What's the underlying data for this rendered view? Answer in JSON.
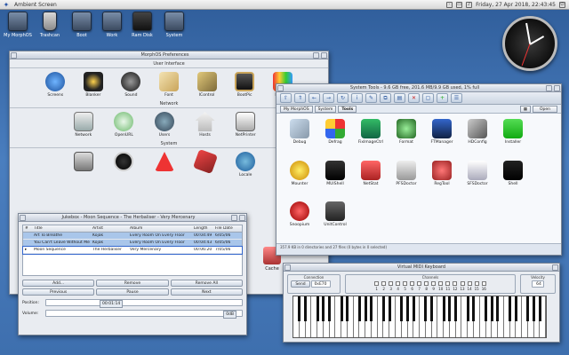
{
  "menubar": {
    "title": "Ambient Screen",
    "datetime": "Friday, 27 Apr 2018, 22:43:45",
    "tray_icons": [
      "chat-icon",
      "screen-icon",
      "volume-icon",
      "power-icon"
    ]
  },
  "desktop_icons": [
    {
      "label": "My MorphOS",
      "icon": "computer-icon"
    },
    {
      "label": "Trashcan",
      "icon": "trash-icon"
    },
    {
      "label": "Boot",
      "icon": "drive-icon"
    },
    {
      "label": "Work",
      "icon": "drive-icon"
    },
    {
      "label": "Ram Disk",
      "icon": "ram-disk-icon"
    },
    {
      "label": "System",
      "icon": "drive-icon"
    }
  ],
  "prefs": {
    "title": "MorphOS Preferences",
    "sections": [
      {
        "title": "User Interface",
        "items": [
          "Screens",
          "Blanker",
          "Sound",
          "Font",
          "IControl",
          "BootPic",
          "Display"
        ]
      },
      {
        "title": "Network",
        "items": [
          "Network",
          "OpenURL",
          "Users",
          "Hosts",
          "NetPrinter"
        ]
      },
      {
        "title": "System",
        "items": [
          "",
          "",
          "",
          "",
          "Locale"
        ]
      }
    ],
    "extra_label": "Cache"
  },
  "systools": {
    "title": "System Tools - 9.6 GB free, 201.6 MB/9.9 GB used, 1% full",
    "crumbs": [
      "My MorphOS",
      "System",
      "Tools"
    ],
    "open_label": "Open",
    "items": [
      "Debug",
      "Defrag",
      "FixImageCtrl",
      "Format",
      "FTManager",
      "HDConfig",
      "Installer",
      "Mounter",
      "MUIShell",
      "NetStat",
      "PFSDoctor",
      "RegTool",
      "SFSDoctor",
      "Shell",
      "Snoopium",
      "UnitControl"
    ],
    "status": "357.9 KB in 0 directories and 27 files (0 bytes in 0 selected)"
  },
  "jukebox": {
    "title": "Jukebox - Moon Sequence - The Herbaliser - Very Mercenary",
    "headers": [
      "#",
      "Title",
      "Artist",
      "Album",
      "Length",
      "File Date"
    ],
    "rows": [
      {
        "num": "",
        "title": "Art To Breathe",
        "artist": "Kojak",
        "album": "Every Room On Every Floor",
        "length": "00:04:49",
        "date": "6/05/06"
      },
      {
        "num": "",
        "title": "You Can't Leave Without Me",
        "artist": "Kojak",
        "album": "Every Room On Every Floor",
        "length": "00:04:43",
        "date": "6/05/06"
      },
      {
        "num": "",
        "title": "Moon Sequence",
        "artist": "The Herbaliser",
        "album": "Very Mercenary",
        "length": "00:06:20",
        "date": "7/05/06"
      }
    ],
    "buttons": [
      "Add...",
      "Remove",
      "Remove All",
      "Previous",
      "Pause",
      "Next"
    ],
    "position_label": "Position:",
    "position_value": "00:01:14",
    "volume_label": "Volume:",
    "volume_value": "0dB"
  },
  "midi": {
    "title": "Virtual MIDI Keyboard",
    "connection_label": "Connection",
    "send_label": "Send",
    "port_value": "0xE70",
    "channels_label": "Channels",
    "channels": [
      "1",
      "2",
      "3",
      "4",
      "5",
      "6",
      "7",
      "8",
      "9",
      "10",
      "11",
      "12",
      "13",
      "14",
      "15",
      "16"
    ],
    "velocity_label": "Velocity",
    "velocity_value": "64"
  },
  "colors": {
    "accent": "#2e5aa0",
    "selection": "#a9c6ea",
    "selection_active": "#7fa8da",
    "desktop": "#3e6fae"
  }
}
